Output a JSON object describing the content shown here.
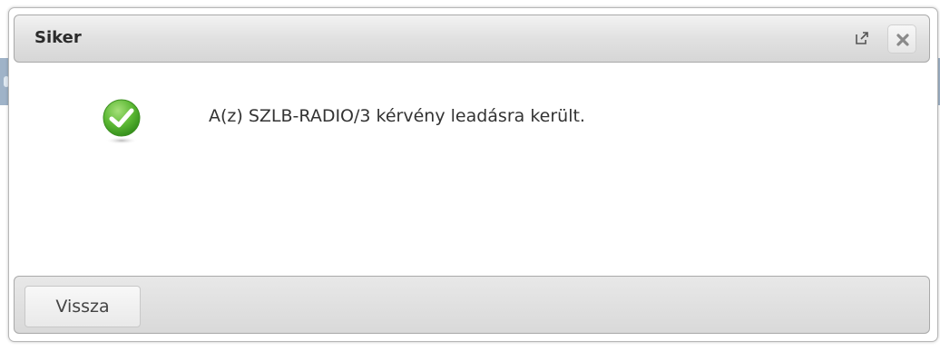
{
  "dialog": {
    "title": "Siker",
    "message": "A(z) SZLB-RADIO/3 kérvény leadásra került.",
    "status_icon": "success-check-icon",
    "popout_icon": "external-link-icon",
    "close_icon": "close-icon",
    "back_label": "Vissza"
  },
  "colors": {
    "success": "#4caf2a",
    "titlebar": "#dcdcdc",
    "text": "#333333"
  }
}
